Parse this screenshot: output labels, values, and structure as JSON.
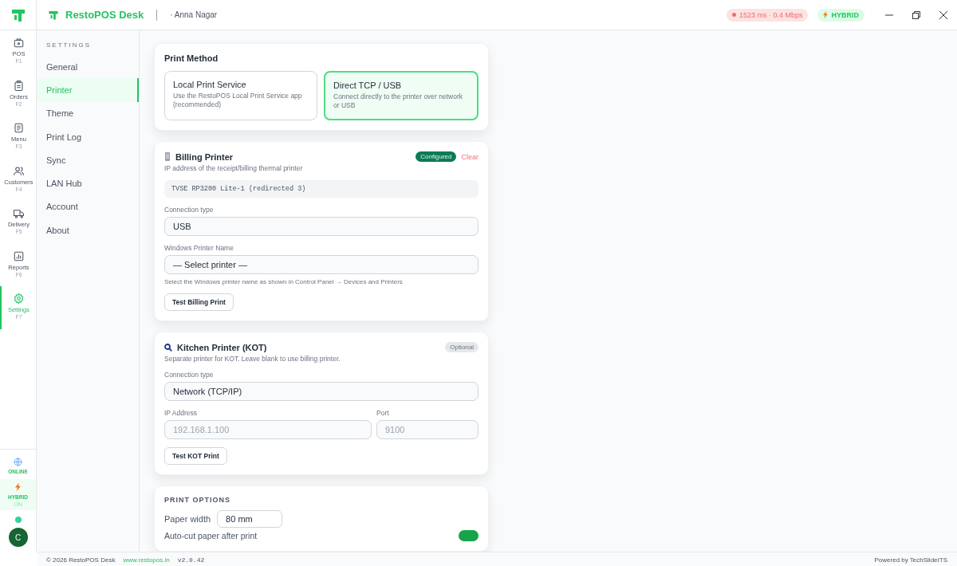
{
  "header": {
    "app_name": "RestoPOS Desk",
    "location": "· Anna Nagar",
    "latency": "1523 ms · 0.4 Mbps",
    "mode": "HYBRID"
  },
  "rail": {
    "items": [
      {
        "label": "POS",
        "key": "F1",
        "selected": false
      },
      {
        "label": "Orders",
        "key": "F2",
        "selected": false
      },
      {
        "label": "Menu",
        "key": "F3",
        "selected": false
      },
      {
        "label": "Customers",
        "key": "F4",
        "selected": false
      },
      {
        "label": "Delivery",
        "key": "F5",
        "selected": false
      },
      {
        "label": "Reports",
        "key": "F6",
        "selected": false
      },
      {
        "label": "Settings",
        "key": "F7",
        "selected": true
      }
    ],
    "status": {
      "label": "ONLINE"
    },
    "mode": {
      "label": "HYBRID",
      "sub": "ON"
    },
    "avatar": "C"
  },
  "settings_nav": {
    "heading": "SETTINGS",
    "items": [
      {
        "label": "General",
        "selected": false
      },
      {
        "label": "Printer",
        "selected": true
      },
      {
        "label": "Theme",
        "selected": false
      },
      {
        "label": "Print Log",
        "selected": false
      },
      {
        "label": "Sync",
        "selected": false
      },
      {
        "label": "LAN Hub",
        "selected": false
      },
      {
        "label": "Account",
        "selected": false
      },
      {
        "label": "About",
        "selected": false
      }
    ]
  },
  "print_method": {
    "title": "Print Method",
    "options": [
      {
        "title": "Local Print Service",
        "description": "Use the RestoPOS Local Print Service app (recommended)",
        "selected": false
      },
      {
        "title": "Direct TCP / USB",
        "description": "Connect directly to the printer over network or USB",
        "selected": true
      }
    ]
  },
  "billing_printer": {
    "title": "Billing Printer",
    "subtitle": "IP address of the receipt/billing thermal printer",
    "badge": "Configured",
    "clear": "Clear",
    "device": "TVSE RP3200 Lite-1 (redirected 3)",
    "connection_label": "Connection type",
    "connection": "USB",
    "printer_label": "Windows Printer Name",
    "printer": "— Select printer —",
    "hint": "Select the Windows printer name as shown in Control Panel → Devices and Printers",
    "test_button": "Test Billing Print"
  },
  "kitchen_printer": {
    "title": "Kitchen Printer (KOT)",
    "subtitle": "Separate printer for KOT. Leave blank to use billing printer.",
    "badge": "Optional",
    "connection_label": "Connection type",
    "connection": "Network (TCP/IP)",
    "ip_label": "IP Address",
    "ip_placeholder": "192.168.1.100",
    "port_label": "Port",
    "port_placeholder": "9100",
    "test_button": "Test KOT Print"
  },
  "print_options": {
    "title": "PRINT OPTIONS",
    "paper_label": "Paper width",
    "paper": "80 mm",
    "autocut_label": "Auto-cut paper after print",
    "autocut": {
      "on": true
    }
  },
  "footer": {
    "copyright": "© 2026 RestoPOS Desk",
    "website": "www.restopos.in",
    "version": "v2.0.42",
    "powered": "Powered by TechSlideITS"
  }
}
